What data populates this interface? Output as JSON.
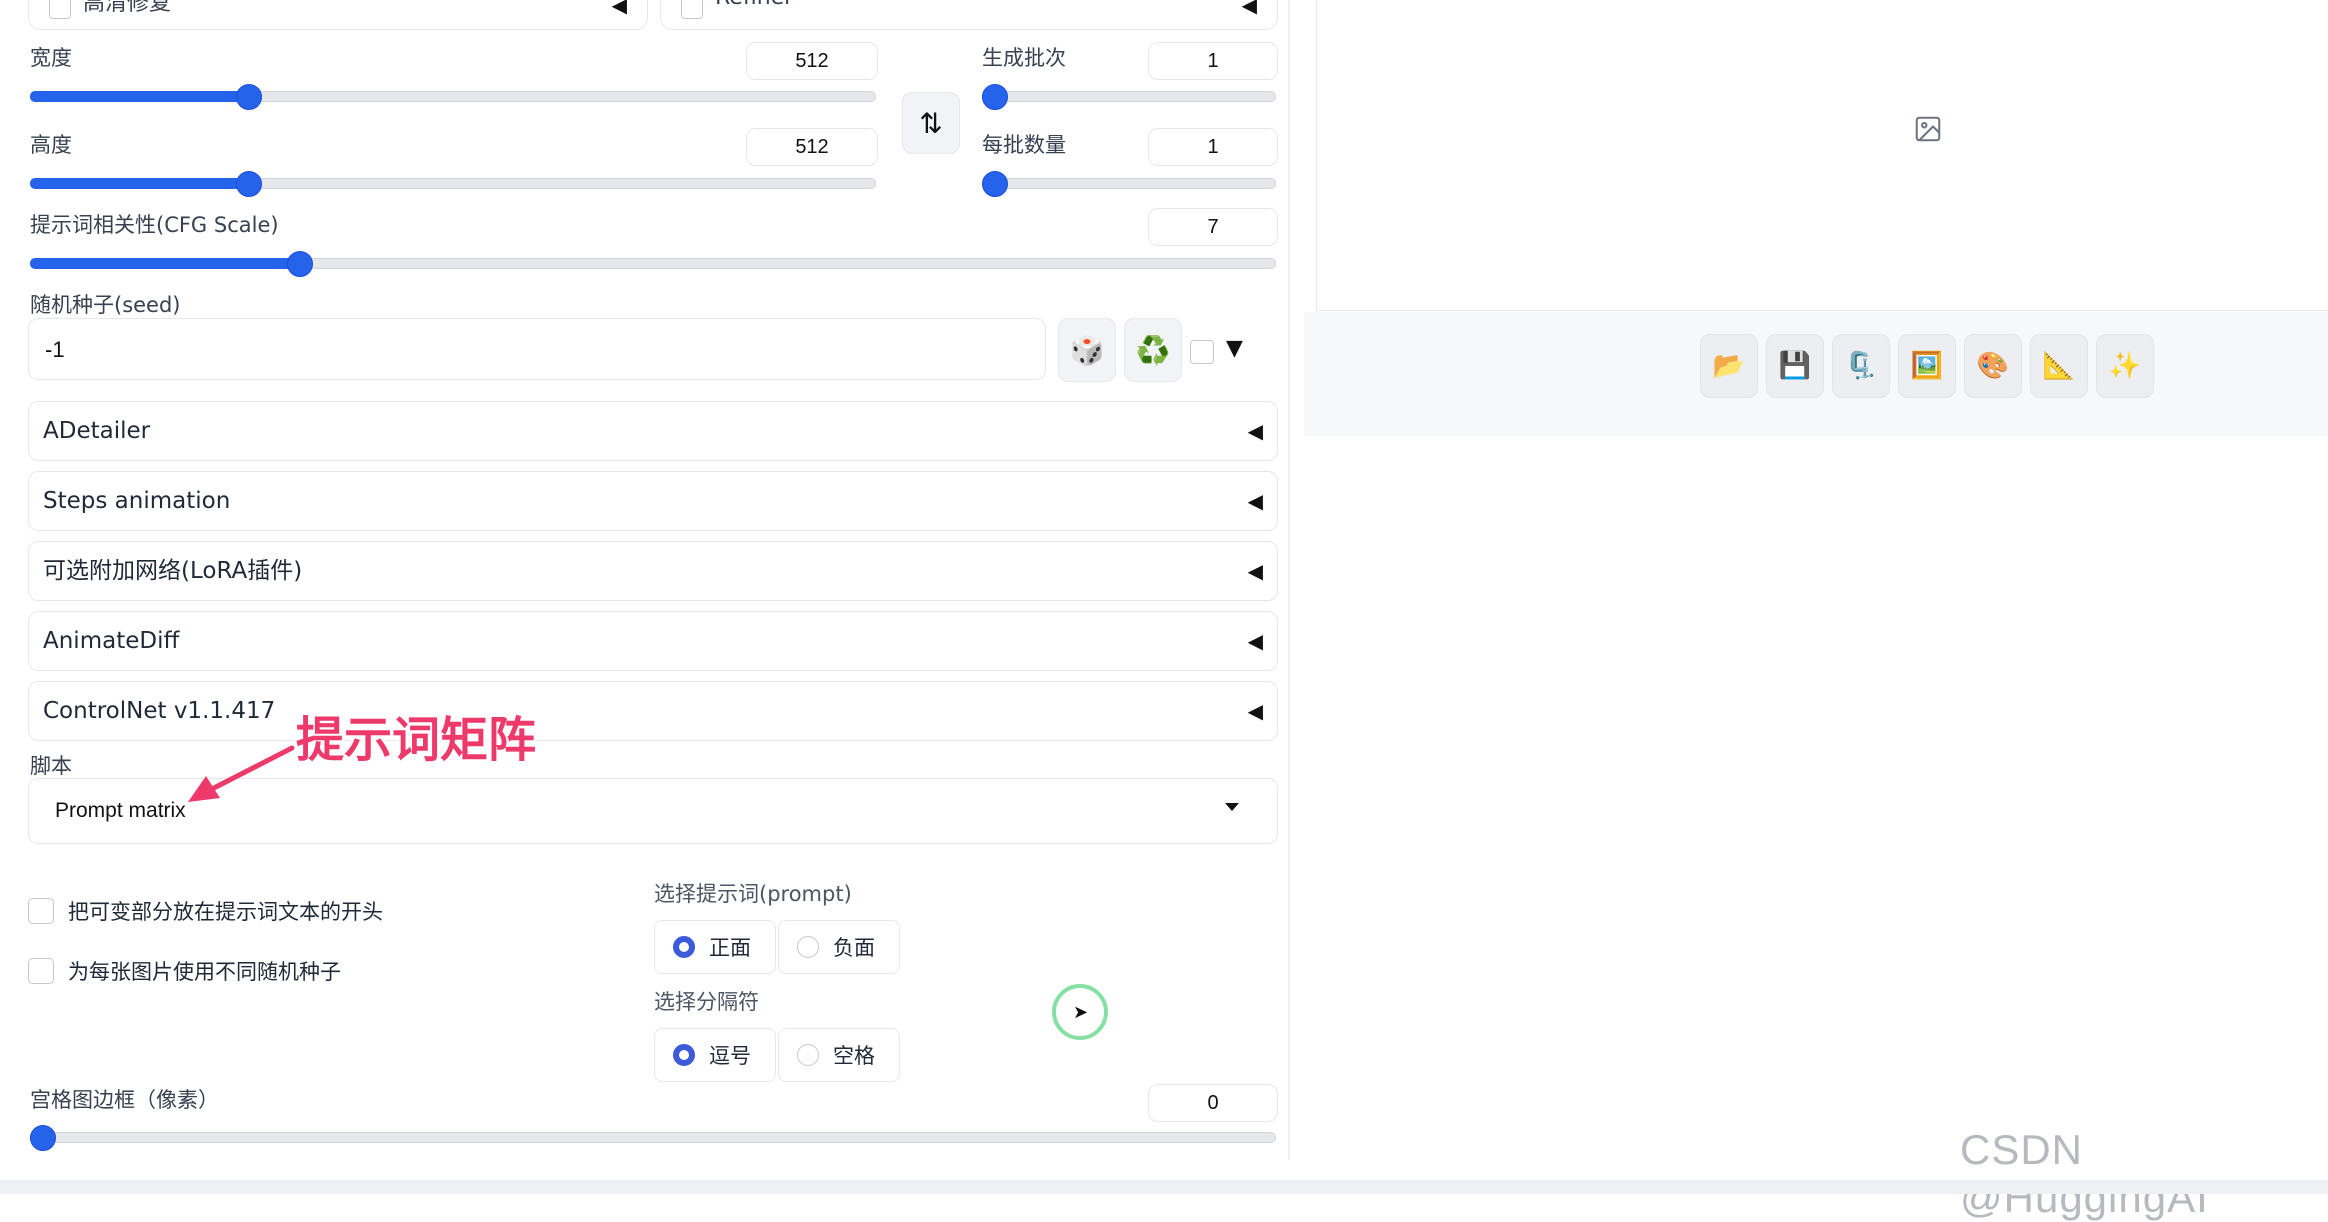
{
  "top": {
    "hires_label": "高清修复",
    "refiner_label": "Refiner"
  },
  "width": {
    "label": "宽度",
    "value": "512",
    "level": 0.25
  },
  "height": {
    "label": "高度",
    "value": "512",
    "level": 0.25
  },
  "batch_count": {
    "label": "生成批次",
    "value": "1",
    "level": 0.0
  },
  "batch_size": {
    "label": "每批数量",
    "value": "1",
    "level": 0.0
  },
  "cfg": {
    "label": "提示词相关性(CFG Scale)",
    "value": "7",
    "level": 0.21
  },
  "seed": {
    "label": "随机种子(seed)",
    "value": "-1",
    "dice_icon": "🎲",
    "recycle_icon": "♻️",
    "extra_toggle": "▼"
  },
  "swap_icon": "⇅",
  "accordions": [
    {
      "label": "ADetailer",
      "arrow": "◀"
    },
    {
      "label": "Steps animation",
      "arrow": "◀"
    },
    {
      "label": "可选附加网络(LoRA插件)",
      "arrow": "◀"
    },
    {
      "label": "AnimateDiff",
      "arrow": "◀"
    },
    {
      "label": "ControlNet v1.1.417",
      "arrow": "◀"
    }
  ],
  "script": {
    "label": "脚本",
    "value": "Prompt matrix"
  },
  "options": {
    "put_variable_start": "把可变部分放在提示词文本的开头",
    "different_seeds": "为每张图片使用不同随机种子"
  },
  "prompt_select": {
    "label": "选择提示词(prompt)",
    "positive": "正面",
    "negative": "负面",
    "selected": "正面"
  },
  "separator_select": {
    "label": "选择分隔符",
    "comma": "逗号",
    "space": "空格",
    "selected": "逗号"
  },
  "margin": {
    "label": "宫格图边框（像素）",
    "value": "0",
    "level": 0.0
  },
  "annotation": "提示词矩阵",
  "output_tools": [
    "📂",
    "💾",
    "🗜️",
    "🖼️",
    "🎨",
    "📐",
    "✨"
  ],
  "image_placeholder_icon": "image-icon",
  "watermark": "CSDN @HuggingAI",
  "colors": {
    "accent": "#2563eb",
    "annotation": "#ee3a6b"
  }
}
